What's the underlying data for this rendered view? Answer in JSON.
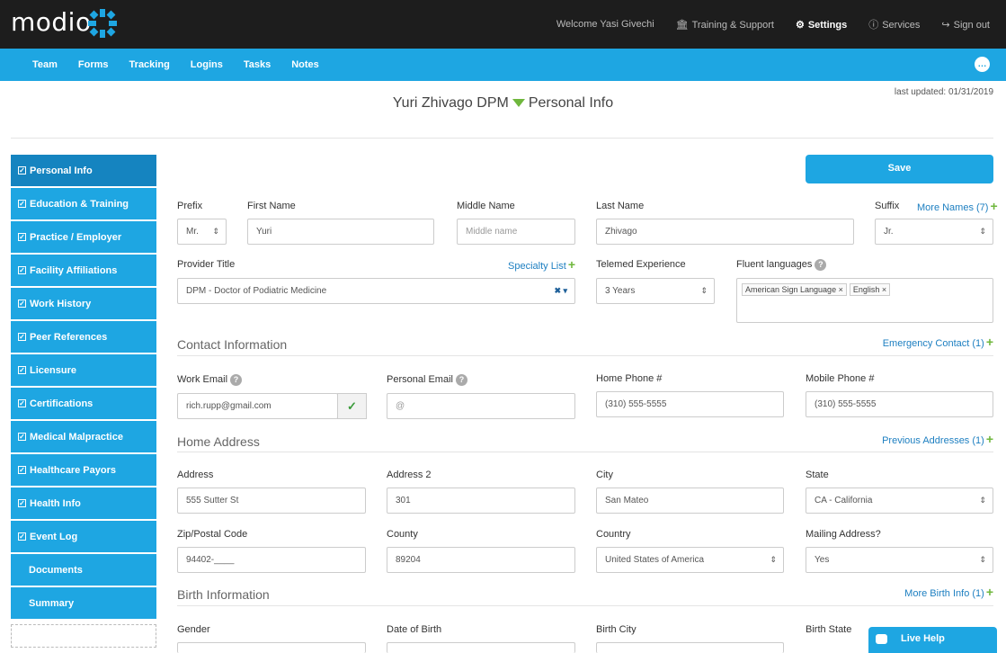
{
  "header": {
    "logo_text": "modio",
    "welcome": "Welcome Yasi Givechi",
    "training": "Training & Support",
    "settings": "Settings",
    "services": "Services",
    "sign_out": "Sign out"
  },
  "navbar": [
    "Team",
    "Forms",
    "Tracking",
    "Logins",
    "Tasks",
    "Notes"
  ],
  "page": {
    "last_updated": "last updated: 01/31/2019",
    "provider": "Yuri Zhivago DPM",
    "section": "Personal Info",
    "save_label": "Save"
  },
  "sidebar": [
    {
      "label": "Personal Info",
      "checked": true
    },
    {
      "label": "Education & Training",
      "checked": true
    },
    {
      "label": "Practice / Employer",
      "checked": true
    },
    {
      "label": "Facility Affiliations",
      "checked": true
    },
    {
      "label": "Work History",
      "checked": true
    },
    {
      "label": "Peer References",
      "checked": true
    },
    {
      "label": "Licensure",
      "checked": true
    },
    {
      "label": "Certifications",
      "checked": true
    },
    {
      "label": "Medical Malpractice",
      "checked": true
    },
    {
      "label": "Healthcare Payors",
      "checked": true
    },
    {
      "label": "Health Info",
      "checked": true
    },
    {
      "label": "Event Log",
      "checked": true
    },
    {
      "label": "Documents",
      "checked": false
    },
    {
      "label": "Summary",
      "checked": false
    }
  ],
  "form": {
    "prefix_label": "Prefix",
    "prefix_value": "Mr.",
    "first_label": "First Name",
    "first_value": "Yuri",
    "middle_label": "Middle Name",
    "middle_placeholder": "Middle name",
    "last_label": "Last Name",
    "last_value": "Zhivago",
    "suffix_label": "Suffix",
    "suffix_value": "Jr.",
    "more_names": "More Names (7)",
    "title_label": "Provider Title",
    "title_value": "DPM - Doctor of Podiatric Medicine",
    "specialty_list": "Specialty List",
    "telemed_label": "Telemed Experience",
    "telemed_value": "3 Years",
    "fluent_label": "Fluent languages",
    "languages": [
      "American Sign Language",
      "English"
    ],
    "contact_section": "Contact Information",
    "emergency_link": "Emergency Contact (1)",
    "work_email_label": "Work Email",
    "work_email_value": "rich.rupp@gmail.com",
    "personal_email_label": "Personal Email",
    "personal_email_placeholder": "@",
    "home_phone_label": "Home Phone #",
    "home_phone_value": "(310) 555-5555",
    "mobile_phone_label": "Mobile Phone #",
    "mobile_phone_value": "(310) 555-5555",
    "home_section": "Home Address",
    "previous_link": "Previous Addresses (1)",
    "address_label": "Address",
    "address_value": "555 Sutter St",
    "address2_label": "Address 2",
    "address2_value": "301",
    "city_label": "City",
    "city_value": "San Mateo",
    "state_label": "State",
    "state_value": "CA - California",
    "zip_label": "Zip/Postal Code",
    "zip_value": "94402-____",
    "county_label": "County",
    "county_value": "89204",
    "country_label": "Country",
    "country_value": "United States of America",
    "mailing_label": "Mailing Address?",
    "mailing_value": "Yes",
    "birth_section": "Birth Information",
    "more_birth_link": "More Birth Info (1)",
    "gender_label": "Gender",
    "dob_label": "Date of Birth",
    "birth_city_label": "Birth City",
    "birth_state_label": "Birth State"
  },
  "live_help": "Live Help"
}
